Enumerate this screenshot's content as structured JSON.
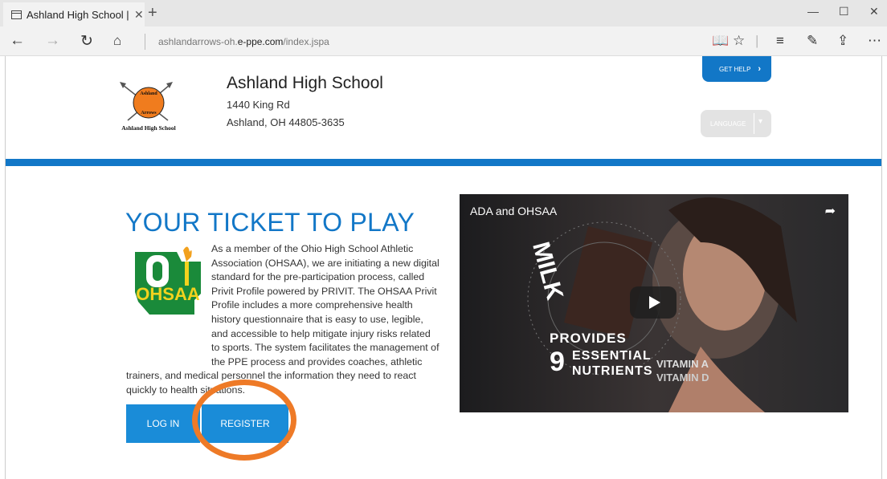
{
  "browser": {
    "tab_title": "Ashland High School | e",
    "url_prefix": "ashlandarrows-oh.",
    "url_domain": "e-ppe.com",
    "url_path": "/index.jspa"
  },
  "header": {
    "school_name": "Ashland High School",
    "address_line1": "1440 King Rd",
    "address_line2": "Ashland, OH 44805-3635",
    "get_help_label": "GET HELP",
    "language_label": "LANGUAGE",
    "logo_caption": "Ashland High School",
    "logo_text": "Ashland Arrows"
  },
  "main": {
    "headline": "YOUR TICKET TO PLAY",
    "body": "As a member of the Ohio High School Athletic Association (OHSAA), we are initiating a new digital standard for the pre-participation process, called Privit Profile powered by PRIVIT.  The OHSAA Privit Profile includes a more comprehensive health history questionnaire that is easy to use, legible, and accessible to help mitigate injury risks related to sports. The system facilitates the management of the PPE process and provides coaches, athletic trainers, and medical personnel the information they need to react quickly to health situations.",
    "ohsaa_logo_text": "OHSAA",
    "login_label": "LOG IN",
    "register_label": "REGISTER"
  },
  "video": {
    "title": "ADA and OHSAA",
    "milk_text": "MILK",
    "provides": "PROVIDES",
    "nine": "9",
    "essential": "ESSENTIAL",
    "nutrients": "NUTRIENTS",
    "vitamin_a": "VITAMIN A",
    "vitamin_d": "VITAMIN D"
  },
  "colors": {
    "brand_blue": "#1277c7",
    "button_blue": "#1a8cd8",
    "annotation_orange": "#ee7a27"
  },
  "icons": [
    "tab-page-icon",
    "close-icon",
    "plus-icon",
    "minimize-icon",
    "maximize-icon",
    "close-window-icon",
    "back-icon",
    "forward-icon",
    "refresh-icon",
    "home-icon",
    "reading-view-icon",
    "favorite-star-icon",
    "hub-icon",
    "web-note-icon",
    "share-icon",
    "more-icon",
    "chevron-right-icon",
    "chevron-down-icon",
    "play-icon"
  ]
}
